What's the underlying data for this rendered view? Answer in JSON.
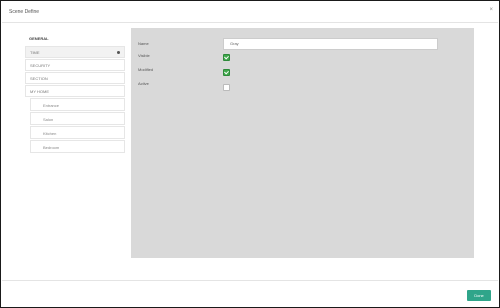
{
  "dialog": {
    "title": "Scene Define",
    "close_glyph": "×"
  },
  "sidebar": {
    "items": [
      {
        "label": "GENERAL"
      },
      {
        "label": "TIME"
      },
      {
        "label": "SECURITY"
      },
      {
        "label": "SECTION"
      },
      {
        "label": "MY HOME"
      }
    ],
    "subitems": [
      {
        "label": "Entrance"
      },
      {
        "label": "Salon"
      },
      {
        "label": "Kitchen"
      },
      {
        "label": "Bedroom"
      }
    ]
  },
  "form": {
    "name_label": "Name",
    "name_value": "Gray",
    "visible_label": "Visible",
    "visible_checked": true,
    "modified_label": "Modified",
    "modified_checked": true,
    "active_label": "Active",
    "active_checked": false
  },
  "footer": {
    "done_label": "Done"
  },
  "colors": {
    "accent": "#2fa58a",
    "check_green": "#3fa84b",
    "panel_bg": "#d9d9d9"
  }
}
